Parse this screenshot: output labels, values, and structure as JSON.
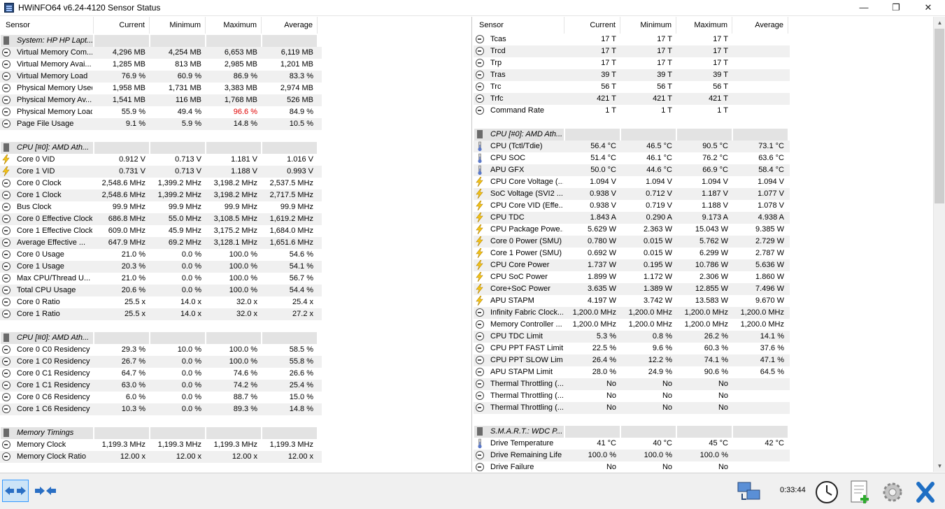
{
  "window": {
    "title": "HWiNFO64 v6.24-4120 Sensor Status",
    "minimize": "—",
    "maximize": "❐",
    "close": "✕"
  },
  "columns": {
    "sensor": "Sensor",
    "current": "Current",
    "minimum": "Minimum",
    "maximum": "Maximum",
    "average": "Average"
  },
  "left_rows": [
    {
      "type": "group",
      "label": "System: HP HP Lapt..."
    },
    {
      "type": "data",
      "icon": "ring",
      "label": "Virtual Memory Com...",
      "cur": "4,296 MB",
      "min": "4,254 MB",
      "max": "6,653 MB",
      "avg": "6,119 MB"
    },
    {
      "type": "data",
      "icon": "ring",
      "label": "Virtual Memory Avai...",
      "cur": "1,285 MB",
      "min": "813 MB",
      "max": "2,985 MB",
      "avg": "1,201 MB"
    },
    {
      "type": "data",
      "icon": "ring",
      "label": "Virtual Memory Load",
      "cur": "76.9 %",
      "min": "60.9 %",
      "max": "86.9 %",
      "avg": "83.3 %"
    },
    {
      "type": "data",
      "icon": "ring",
      "label": "Physical Memory Used",
      "cur": "1,958 MB",
      "min": "1,731 MB",
      "max": "3,383 MB",
      "avg": "2,974 MB"
    },
    {
      "type": "data",
      "icon": "ring",
      "label": "Physical Memory Av...",
      "cur": "1,541 MB",
      "min": "116 MB",
      "max": "1,768 MB",
      "avg": "526 MB"
    },
    {
      "type": "data",
      "icon": "ring",
      "label": "Physical Memory Load",
      "cur": "55.9 %",
      "min": "49.4 %",
      "max": "96.6 %",
      "avg": "84.9 %",
      "max_red": true
    },
    {
      "type": "data",
      "icon": "ring",
      "label": "Page File Usage",
      "cur": "9.1 %",
      "min": "5.9 %",
      "max": "14.8 %",
      "avg": "10.5 %"
    },
    {
      "type": "blank"
    },
    {
      "type": "group",
      "label": "CPU [#0]: AMD Ath..."
    },
    {
      "type": "data",
      "icon": "bolt",
      "label": "Core 0 VID",
      "cur": "0.912 V",
      "min": "0.713 V",
      "max": "1.181 V",
      "avg": "1.016 V"
    },
    {
      "type": "data",
      "icon": "bolt",
      "label": "Core 1 VID",
      "cur": "0.731 V",
      "min": "0.713 V",
      "max": "1.188 V",
      "avg": "0.993 V"
    },
    {
      "type": "data",
      "icon": "ring",
      "label": "Core 0 Clock",
      "cur": "2,548.6 MHz",
      "min": "1,399.2 MHz",
      "max": "3,198.2 MHz",
      "avg": "2,537.5 MHz"
    },
    {
      "type": "data",
      "icon": "ring",
      "label": "Core 1 Clock",
      "cur": "2,548.6 MHz",
      "min": "1,399.2 MHz",
      "max": "3,198.2 MHz",
      "avg": "2,717.5 MHz"
    },
    {
      "type": "data",
      "icon": "ring",
      "label": "Bus Clock",
      "cur": "99.9 MHz",
      "min": "99.9 MHz",
      "max": "99.9 MHz",
      "avg": "99.9 MHz"
    },
    {
      "type": "data",
      "icon": "ring",
      "label": "Core 0 Effective Clock",
      "cur": "686.8 MHz",
      "min": "55.0 MHz",
      "max": "3,108.5 MHz",
      "avg": "1,619.2 MHz"
    },
    {
      "type": "data",
      "icon": "ring",
      "label": "Core 1 Effective Clock",
      "cur": "609.0 MHz",
      "min": "45.9 MHz",
      "max": "3,175.2 MHz",
      "avg": "1,684.0 MHz"
    },
    {
      "type": "data",
      "icon": "ring",
      "label": "Average Effective ...",
      "cur": "647.9 MHz",
      "min": "69.2 MHz",
      "max": "3,128.1 MHz",
      "avg": "1,651.6 MHz"
    },
    {
      "type": "data",
      "icon": "ring",
      "label": "Core 0 Usage",
      "cur": "21.0 %",
      "min": "0.0 %",
      "max": "100.0 %",
      "avg": "54.6 %"
    },
    {
      "type": "data",
      "icon": "ring",
      "label": "Core 1 Usage",
      "cur": "20.3 %",
      "min": "0.0 %",
      "max": "100.0 %",
      "avg": "54.1 %"
    },
    {
      "type": "data",
      "icon": "ring",
      "label": "Max CPU/Thread U...",
      "cur": "21.0 %",
      "min": "0.0 %",
      "max": "100.0 %",
      "avg": "56.7 %"
    },
    {
      "type": "data",
      "icon": "ring",
      "label": "Total CPU Usage",
      "cur": "20.6 %",
      "min": "0.0 %",
      "max": "100.0 %",
      "avg": "54.4 %"
    },
    {
      "type": "data",
      "icon": "ring",
      "label": "Core 0 Ratio",
      "cur": "25.5 x",
      "min": "14.0 x",
      "max": "32.0 x",
      "avg": "25.4 x"
    },
    {
      "type": "data",
      "icon": "ring",
      "label": "Core 1 Ratio",
      "cur": "25.5 x",
      "min": "14.0 x",
      "max": "32.0 x",
      "avg": "27.2 x"
    },
    {
      "type": "blank"
    },
    {
      "type": "group",
      "label": "CPU [#0]: AMD Ath..."
    },
    {
      "type": "data",
      "icon": "ring",
      "label": "Core 0 C0 Residency",
      "cur": "29.3 %",
      "min": "10.0 %",
      "max": "100.0 %",
      "avg": "58.5 %"
    },
    {
      "type": "data",
      "icon": "ring",
      "label": "Core 1 C0 Residency",
      "cur": "26.7 %",
      "min": "0.0 %",
      "max": "100.0 %",
      "avg": "55.8 %"
    },
    {
      "type": "data",
      "icon": "ring",
      "label": "Core 0 C1 Residency",
      "cur": "64.7 %",
      "min": "0.0 %",
      "max": "74.6 %",
      "avg": "26.6 %"
    },
    {
      "type": "data",
      "icon": "ring",
      "label": "Core 1 C1 Residency",
      "cur": "63.0 %",
      "min": "0.0 %",
      "max": "74.2 %",
      "avg": "25.4 %"
    },
    {
      "type": "data",
      "icon": "ring",
      "label": "Core 0 C6 Residency",
      "cur": "6.0 %",
      "min": "0.0 %",
      "max": "88.7 %",
      "avg": "15.0 %"
    },
    {
      "type": "data",
      "icon": "ring",
      "label": "Core 1 C6 Residency",
      "cur": "10.3 %",
      "min": "0.0 %",
      "max": "89.3 %",
      "avg": "14.8 %"
    },
    {
      "type": "blank"
    },
    {
      "type": "group",
      "label": "Memory Timings"
    },
    {
      "type": "data",
      "icon": "ring",
      "label": "Memory Clock",
      "cur": "1,199.3 MHz",
      "min": "1,199.3 MHz",
      "max": "1,199.3 MHz",
      "avg": "1,199.3 MHz"
    },
    {
      "type": "data",
      "icon": "ring",
      "label": "Memory Clock Ratio",
      "cur": "12.00 x",
      "min": "12.00 x",
      "max": "12.00 x",
      "avg": "12.00 x"
    }
  ],
  "right_rows": [
    {
      "type": "data",
      "icon": "ring",
      "label": "Tcas",
      "cur": "17 T",
      "min": "17 T",
      "max": "17 T",
      "avg": ""
    },
    {
      "type": "data",
      "icon": "ring",
      "label": "Trcd",
      "cur": "17 T",
      "min": "17 T",
      "max": "17 T",
      "avg": ""
    },
    {
      "type": "data",
      "icon": "ring",
      "label": "Trp",
      "cur": "17 T",
      "min": "17 T",
      "max": "17 T",
      "avg": ""
    },
    {
      "type": "data",
      "icon": "ring",
      "label": "Tras",
      "cur": "39 T",
      "min": "39 T",
      "max": "39 T",
      "avg": ""
    },
    {
      "type": "data",
      "icon": "ring",
      "label": "Trc",
      "cur": "56 T",
      "min": "56 T",
      "max": "56 T",
      "avg": ""
    },
    {
      "type": "data",
      "icon": "ring",
      "label": "Trfc",
      "cur": "421 T",
      "min": "421 T",
      "max": "421 T",
      "avg": ""
    },
    {
      "type": "data",
      "icon": "ring",
      "label": "Command Rate",
      "cur": "1 T",
      "min": "1 T",
      "max": "1 T",
      "avg": ""
    },
    {
      "type": "blank"
    },
    {
      "type": "group",
      "label": "CPU [#0]: AMD Ath..."
    },
    {
      "type": "data",
      "icon": "therm",
      "label": "CPU (Tctl/Tdie)",
      "cur": "56.4 °C",
      "min": "46.5 °C",
      "max": "90.5 °C",
      "avg": "73.1 °C"
    },
    {
      "type": "data",
      "icon": "therm",
      "label": "CPU SOC",
      "cur": "51.4 °C",
      "min": "46.1 °C",
      "max": "76.2 °C",
      "avg": "63.6 °C"
    },
    {
      "type": "data",
      "icon": "therm",
      "label": "APU GFX",
      "cur": "50.0 °C",
      "min": "44.6 °C",
      "max": "66.9 °C",
      "avg": "58.4 °C"
    },
    {
      "type": "data",
      "icon": "bolt",
      "label": "CPU Core Voltage (...",
      "cur": "1.094 V",
      "min": "1.094 V",
      "max": "1.094 V",
      "avg": "1.094 V"
    },
    {
      "type": "data",
      "icon": "bolt",
      "label": "SoC Voltage (SVI2 ...",
      "cur": "0.938 V",
      "min": "0.712 V",
      "max": "1.187 V",
      "avg": "1.077 V"
    },
    {
      "type": "data",
      "icon": "bolt",
      "label": "CPU Core VID (Effe...",
      "cur": "0.938 V",
      "min": "0.719 V",
      "max": "1.188 V",
      "avg": "1.078 V"
    },
    {
      "type": "data",
      "icon": "bolt",
      "label": "CPU TDC",
      "cur": "1.843 A",
      "min": "0.290 A",
      "max": "9.173 A",
      "avg": "4.938 A"
    },
    {
      "type": "data",
      "icon": "bolt",
      "label": "CPU Package Powe...",
      "cur": "5.629 W",
      "min": "2.363 W",
      "max": "15.043 W",
      "avg": "9.385 W"
    },
    {
      "type": "data",
      "icon": "bolt",
      "label": "Core 0 Power (SMU)",
      "cur": "0.780 W",
      "min": "0.015 W",
      "max": "5.762 W",
      "avg": "2.729 W"
    },
    {
      "type": "data",
      "icon": "bolt",
      "label": "Core 1 Power (SMU)",
      "cur": "0.692 W",
      "min": "0.015 W",
      "max": "6.299 W",
      "avg": "2.787 W"
    },
    {
      "type": "data",
      "icon": "bolt",
      "label": "CPU Core Power",
      "cur": "1.737 W",
      "min": "0.195 W",
      "max": "10.786 W",
      "avg": "5.636 W"
    },
    {
      "type": "data",
      "icon": "bolt",
      "label": "CPU SoC Power",
      "cur": "1.899 W",
      "min": "1.172 W",
      "max": "2.306 W",
      "avg": "1.860 W"
    },
    {
      "type": "data",
      "icon": "bolt",
      "label": "Core+SoC Power",
      "cur": "3.635 W",
      "min": "1.389 W",
      "max": "12.855 W",
      "avg": "7.496 W"
    },
    {
      "type": "data",
      "icon": "bolt",
      "label": "APU STAPM",
      "cur": "4.197 W",
      "min": "3.742 W",
      "max": "13.583 W",
      "avg": "9.670 W"
    },
    {
      "type": "data",
      "icon": "ring",
      "label": "Infinity Fabric Clock...",
      "cur": "1,200.0 MHz",
      "min": "1,200.0 MHz",
      "max": "1,200.0 MHz",
      "avg": "1,200.0 MHz"
    },
    {
      "type": "data",
      "icon": "ring",
      "label": "Memory Controller ...",
      "cur": "1,200.0 MHz",
      "min": "1,200.0 MHz",
      "max": "1,200.0 MHz",
      "avg": "1,200.0 MHz"
    },
    {
      "type": "data",
      "icon": "ring",
      "label": "CPU TDC Limit",
      "cur": "5.3 %",
      "min": "0.8 %",
      "max": "26.2 %",
      "avg": "14.1 %"
    },
    {
      "type": "data",
      "icon": "ring",
      "label": "CPU PPT FAST Limit",
      "cur": "22.5 %",
      "min": "9.6 %",
      "max": "60.3 %",
      "avg": "37.6 %"
    },
    {
      "type": "data",
      "icon": "ring",
      "label": "CPU PPT SLOW Limit",
      "cur": "26.4 %",
      "min": "12.2 %",
      "max": "74.1 %",
      "avg": "47.1 %"
    },
    {
      "type": "data",
      "icon": "ring",
      "label": "APU STAPM Limit",
      "cur": "28.0 %",
      "min": "24.9 %",
      "max": "90.6 %",
      "avg": "64.5 %"
    },
    {
      "type": "data",
      "icon": "ring",
      "label": "Thermal Throttling (...",
      "cur": "No",
      "min": "No",
      "max": "No",
      "avg": ""
    },
    {
      "type": "data",
      "icon": "ring",
      "label": "Thermal Throttling (...",
      "cur": "No",
      "min": "No",
      "max": "No",
      "avg": ""
    },
    {
      "type": "data",
      "icon": "ring",
      "label": "Thermal Throttling (...",
      "cur": "No",
      "min": "No",
      "max": "No",
      "avg": ""
    },
    {
      "type": "blank"
    },
    {
      "type": "group",
      "label": "S.M.A.R.T.: WDC P..."
    },
    {
      "type": "data",
      "icon": "therm",
      "label": "Drive Temperature",
      "cur": "41 °C",
      "min": "40 °C",
      "max": "45 °C",
      "avg": "42 °C"
    },
    {
      "type": "data",
      "icon": "ring",
      "label": "Drive Remaining Life",
      "cur": "100.0 %",
      "min": "100.0 %",
      "max": "100.0 %",
      "avg": ""
    },
    {
      "type": "data",
      "icon": "ring",
      "label": "Drive Failure",
      "cur": "No",
      "min": "No",
      "max": "No",
      "avg": ""
    }
  ],
  "status": {
    "elapsed": "0:33:44"
  }
}
